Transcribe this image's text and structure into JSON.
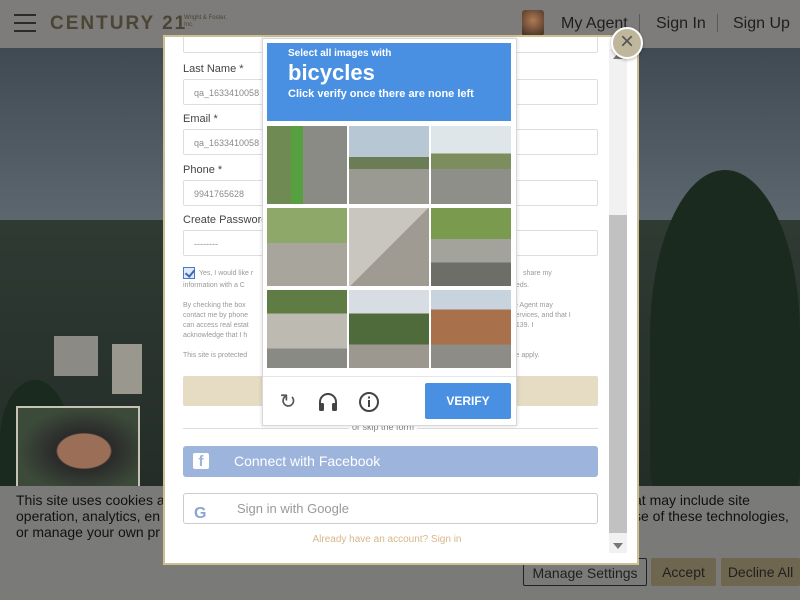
{
  "header": {
    "logo": "CENTURY 21",
    "logo_sub": "Wright & Foster, Inc.",
    "nav": {
      "my_agent": "My Agent",
      "sign_in": "Sign In",
      "sign_up": "Sign Up"
    }
  },
  "form": {
    "last_name_label": "Last Name *",
    "last_name_value": "qa_1633410058",
    "email_label": "Email *",
    "email_value": "qa_1633410058",
    "phone_label": "Phone *",
    "phone_value": "9941765628",
    "password_label": "Create Password",
    "password_value": "--------",
    "checkbox_text_left": "Yes, I would like r",
    "checkbox_text_right": "share my",
    "info_line_left": "information with a C",
    "info_line_right": "eeds.",
    "consent_1_left": "By checking the box",
    "consent_1_right": "te Agent may",
    "consent_2_left": "contact me by phone",
    "consent_2_right": "services, and that I",
    "consent_3_left": "can access real estat",
    "consent_3_right": "6139. I",
    "consent_4_left": "acknowledge that I h",
    "protected_left": "This site is protected",
    "protected_right": "ce apply.",
    "skip_text": "or skip the form",
    "facebook_label": "Connect with Facebook",
    "google_label": "Sign in with Google",
    "login_link": "Already have an account? Sign in"
  },
  "captcha": {
    "instruction_top": "Select all images with",
    "target": "bicycles",
    "instruction_bottom": "Click verify once there are none left",
    "verify_label": "VERIFY"
  },
  "cookie": {
    "text_1": "This site uses cookies a",
    "text_1_right": "at may include site",
    "text_2": "operation, analytics, en",
    "text_2_right": "se of these technologies,",
    "text_3": "or manage your own pr",
    "manage_label": "Manage Settings",
    "accept_label": "Accept",
    "decline_label": "Decline All"
  },
  "colors": {
    "captcha_blue": "#4a90e2",
    "facebook": "#9db4dc",
    "gold_border": "#cdbf8f"
  }
}
